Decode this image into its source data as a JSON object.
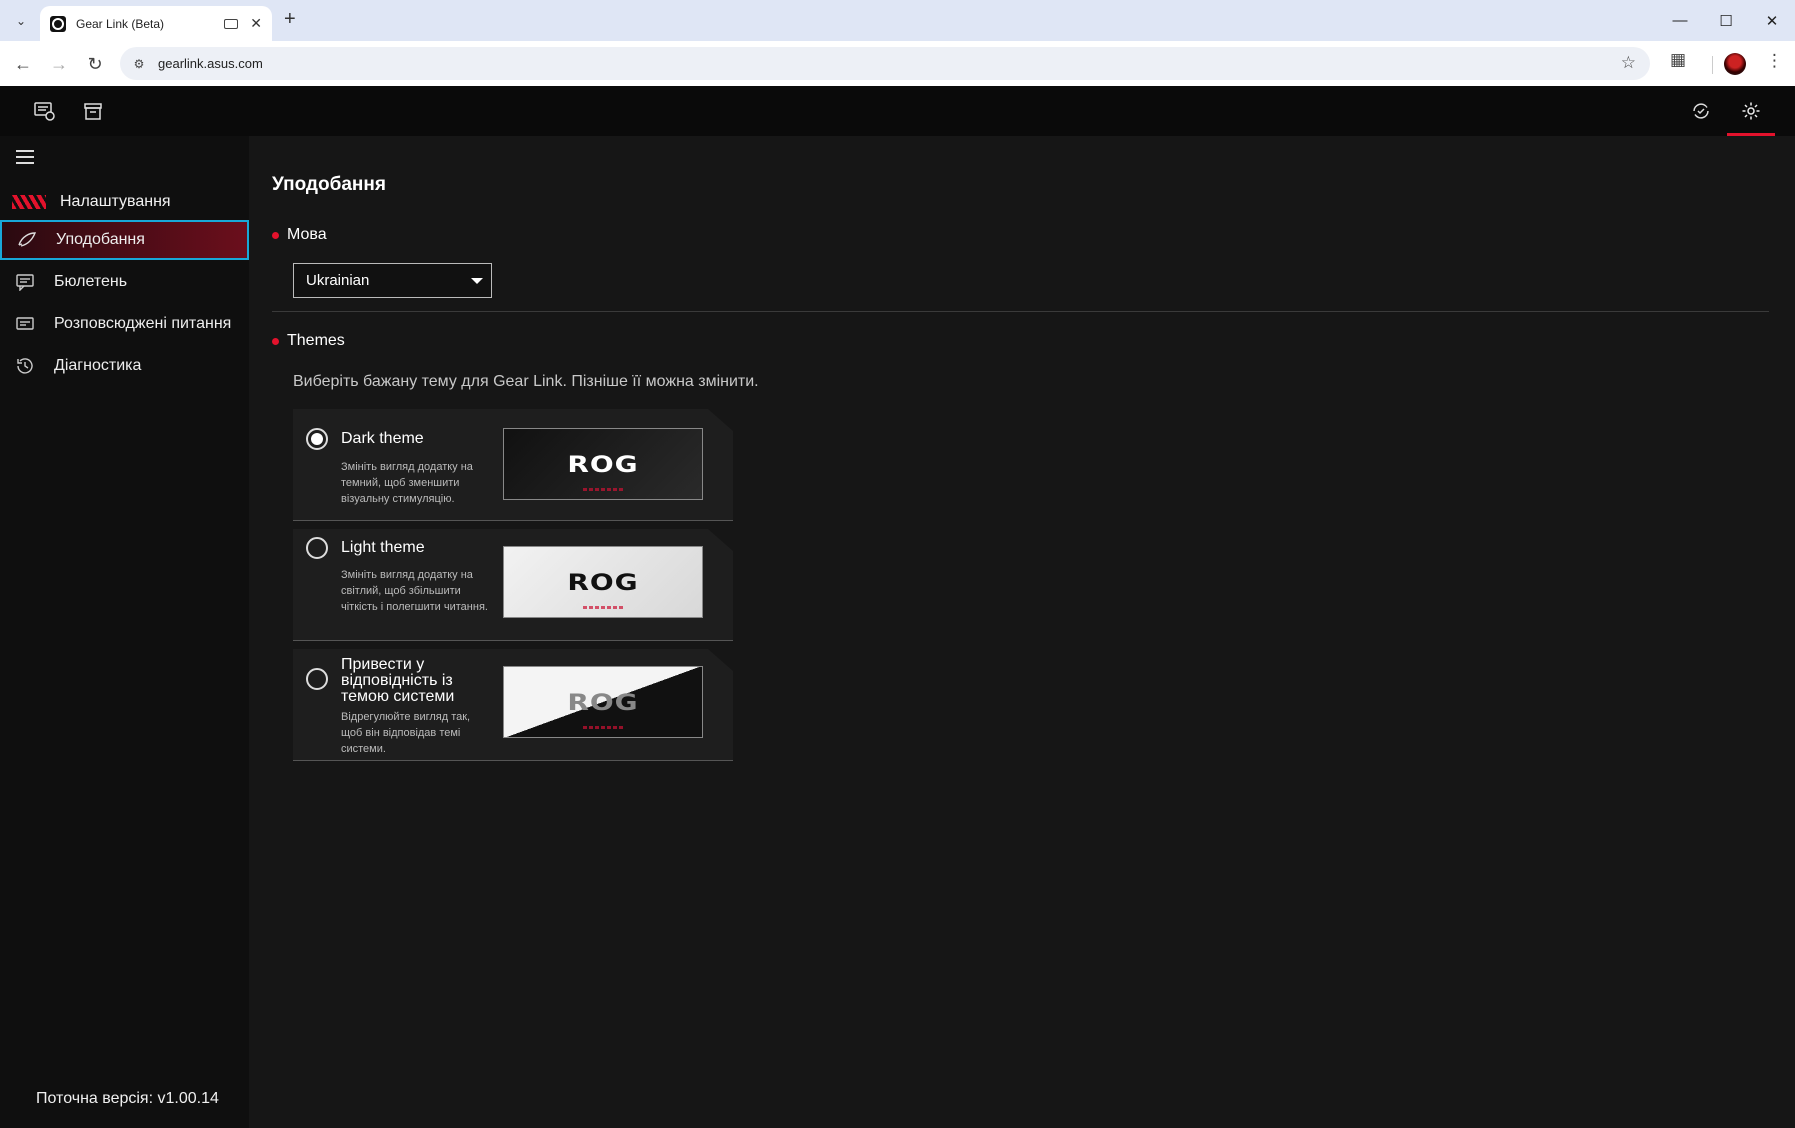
{
  "browser": {
    "tab_title": "Gear Link (Beta)",
    "url": "gearlink.asus.com",
    "new_tab_symbol": "+",
    "close_symbol": "✕"
  },
  "sidebar": {
    "header_label": "Налаштування",
    "items": [
      {
        "label": "Уподобання",
        "icon": "brush-icon",
        "active": true
      },
      {
        "label": "Бюлетень",
        "icon": "message-icon",
        "active": false
      },
      {
        "label": "Розповсюджені питання",
        "icon": "faq-icon",
        "active": false
      },
      {
        "label": "Діагностика",
        "icon": "history-icon",
        "active": false
      }
    ],
    "version": "Поточна версія: v1.00.14"
  },
  "main": {
    "title": "Уподобання",
    "language": {
      "label": "Мова",
      "selected": "Ukrainian"
    },
    "themes": {
      "label": "Themes",
      "description": "Виберіть бажану тему для Gear Link. Пізніше її можна змінити.",
      "options": [
        {
          "name": "Dark theme",
          "description": "Змініть вигляд додатку на темний, щоб зменшити візуальну стимуляцію.",
          "checked": true,
          "preview": "dark"
        },
        {
          "name": "Light theme",
          "description": "Змініть вигляд додатку на світлий, щоб збільшити чіткість і полегшити читання.",
          "checked": false,
          "preview": "light"
        },
        {
          "name": "Привести у відповідність із темою системи",
          "description": "Відрегулюйте вигляд так, щоб він відповідав темі системи.",
          "checked": false,
          "preview": "split"
        }
      ],
      "preview_logo": "ROG"
    }
  },
  "colors": {
    "accent": "#e3122c",
    "focus_outline": "#18a8d8",
    "background": "#161616"
  }
}
